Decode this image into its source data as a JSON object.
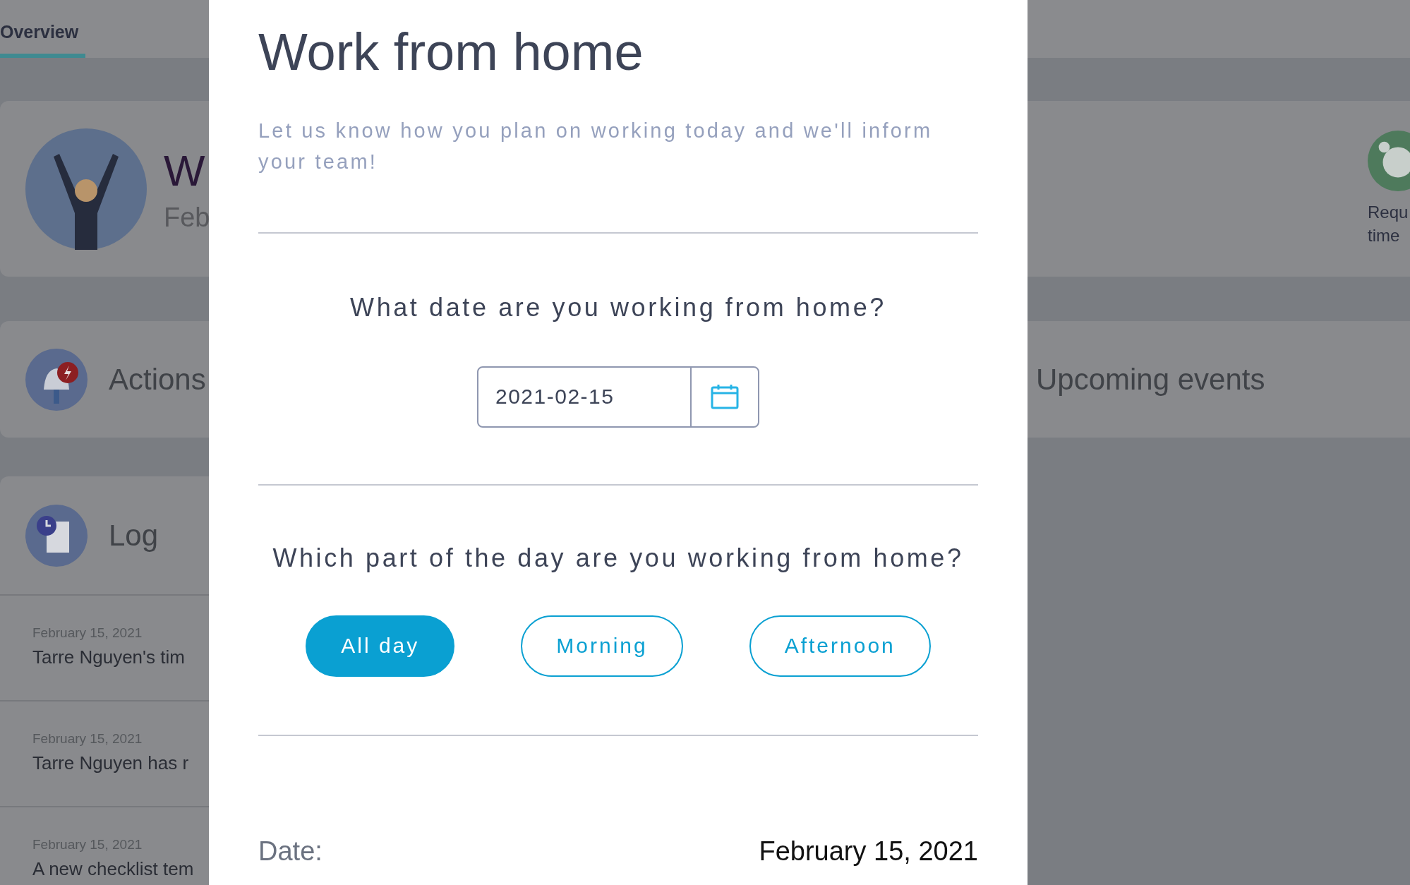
{
  "background": {
    "tab": {
      "label": "Overview",
      "selected": true
    },
    "welcome_card": {
      "title": "W",
      "subtitle": "Feb"
    },
    "quick_action": {
      "label_lines": [
        "Requ",
        "time"
      ]
    },
    "actions_card": {
      "title": "Actions"
    },
    "upcoming_card": {
      "title": "Upcoming events"
    },
    "log": {
      "title": "Log",
      "entries": [
        {
          "date": "February 15, 2021",
          "text": "Tarre Nguyen's tim"
        },
        {
          "date": "February 15, 2021",
          "text": "Tarre Nguyen has r"
        },
        {
          "date": "February 15, 2021",
          "text": "A new checklist tem"
        }
      ]
    }
  },
  "dialog": {
    "title": "Work from home",
    "intro": "Let us know how you plan on working today and we'll inform your team!",
    "date_question": "What date are you working from home?",
    "date_field": {
      "value": "2021-02-15"
    },
    "part_question": "Which part of the day are you working from home?",
    "part_options": [
      {
        "label": "All day",
        "selected": true
      },
      {
        "label": "Morning",
        "selected": false
      },
      {
        "label": "Afternoon",
        "selected": false
      }
    ],
    "summary": {
      "label": "Date:",
      "value": "February 15, 2021"
    }
  }
}
